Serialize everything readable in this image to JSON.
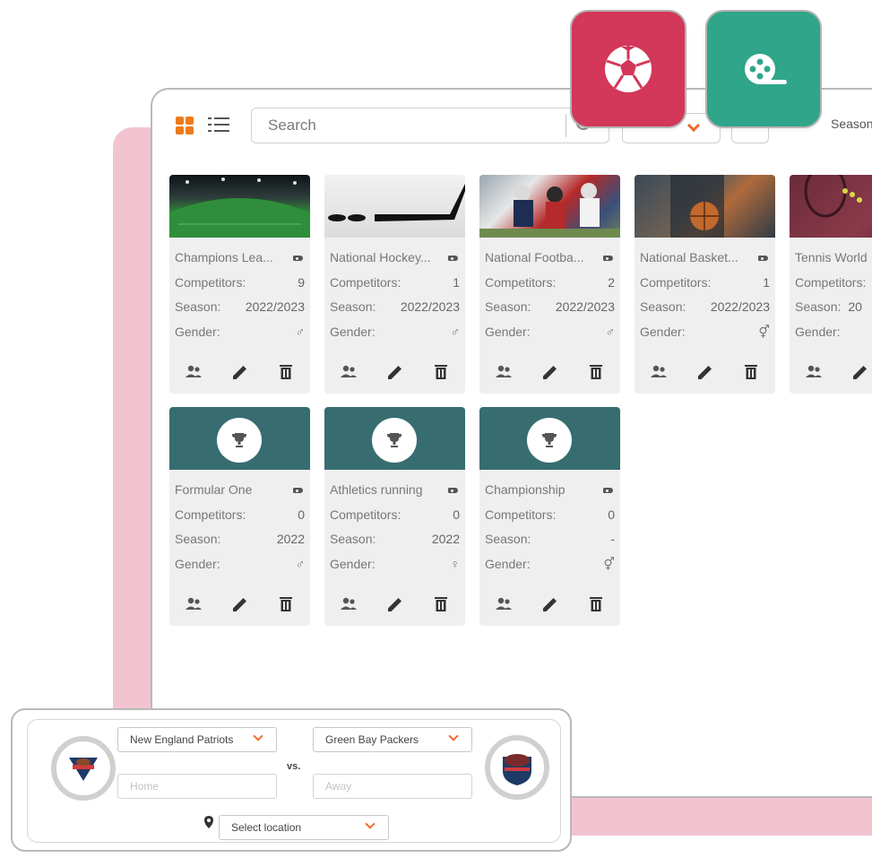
{
  "toolbar": {
    "search_placeholder": "Search",
    "season_label": "Season",
    "view_grid_icon": "grid-view-icon",
    "view_list_icon": "list-view-icon"
  },
  "floating_icons": [
    {
      "name": "soccer-ball-icon",
      "color": "#d3375a"
    },
    {
      "name": "film-reel-icon",
      "color": "#2fa58a"
    }
  ],
  "labels": {
    "competitors": "Competitors:",
    "season": "Season:",
    "gender": "Gender:"
  },
  "cards": [
    {
      "title": "Champions Lea...",
      "competitors": "9",
      "season": "2022/2023",
      "gender_icon": "male-icon",
      "image": "soccer-stadium"
    },
    {
      "title": "National Hockey...",
      "competitors": "1",
      "season": "2022/2023",
      "gender_icon": "male-icon",
      "image": "hockey-stick-pucks"
    },
    {
      "title": "National Footba...",
      "competitors": "2",
      "season": "2022/2023",
      "gender_icon": "male-icon",
      "image": "american-football-players"
    },
    {
      "title": "National Basket...",
      "competitors": "1",
      "season": "2022/2023",
      "gender_icon": "mixed-gender-icon",
      "image": "basketball-player"
    },
    {
      "title": "Tennis World",
      "competitors": "",
      "season": "20",
      "gender_icon": "",
      "image": "tennis-ball-racket"
    },
    {
      "title": "Formular One",
      "competitors": "0",
      "season": "2022",
      "gender_icon": "male-icon",
      "image": "trophy-icon"
    },
    {
      "title": "Athletics running",
      "competitors": "0",
      "season": "2022",
      "gender_icon": "female-icon",
      "image": "trophy-icon"
    },
    {
      "title": "Championship",
      "competitors": "0",
      "season": "-",
      "gender_icon": "mixed-gender-icon",
      "image": "trophy-icon"
    }
  ],
  "match": {
    "home_team": "New England Patriots",
    "away_team": "Green Bay Packers",
    "vs": "vs.",
    "home_placeholder": "Home",
    "away_placeholder": "Away",
    "location_placeholder": "Select location"
  },
  "colors": {
    "accent_orange": "#ef6a2f",
    "teal_header": "#376d70",
    "pink_backdrop": "#f2c4d0",
    "card_bg": "#efefef"
  }
}
